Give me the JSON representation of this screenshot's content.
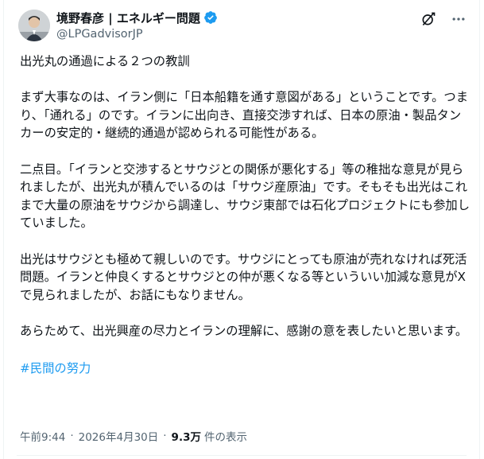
{
  "author": {
    "display_name": "境野春彦 | エネルギー問題",
    "handle": "@LPGadvisorJP",
    "verified": true
  },
  "tweet": {
    "paragraphs": [
      "出光丸の通過による２つの教訓",
      "まず大事なのは、イラン側に「日本船籍を通す意図がある」ということです。つまり、「通れる」のです。イランに出向き、直接交渉すれば、日本の原油・製品タンカーの安定的・継続的通過が認められる可能性がある。",
      "二点目。「イランと交渉するとサウジとの関係が悪化する」等の稚拙な意見が見られましたが、出光丸が積んでいるのは「サウジ産原油」です。そもそも出光はこれまで大量の原油をサウジから調達し、サウジ東部では石化プロジェクトにも参加していました。",
      "出光はサウジとも極めて親しいのです。サウジにとっても原油が売れなければ死活問題。イランと仲良くするとサウジとの仲が悪くなる等といういい加減な意見がXで見られましたが、お話にもなりません。",
      "あらためて、出光興産の尽力とイランの理解に、感謝の意を表したいと思います。"
    ],
    "hashtag": "#民間の努力"
  },
  "meta": {
    "time": "午前9:44",
    "separator": "·",
    "date": "2026年4月30日",
    "views_count": "9.3万",
    "views_label": "件の表示"
  },
  "colors": {
    "link": "#1d9bf0",
    "secondary_text": "#536471",
    "primary_text": "#0f1419",
    "verified_badge": "#1d9bf0"
  },
  "icons": {
    "verified": "verified-badge-icon",
    "grok": "grok-icon",
    "more": "more-icon"
  }
}
